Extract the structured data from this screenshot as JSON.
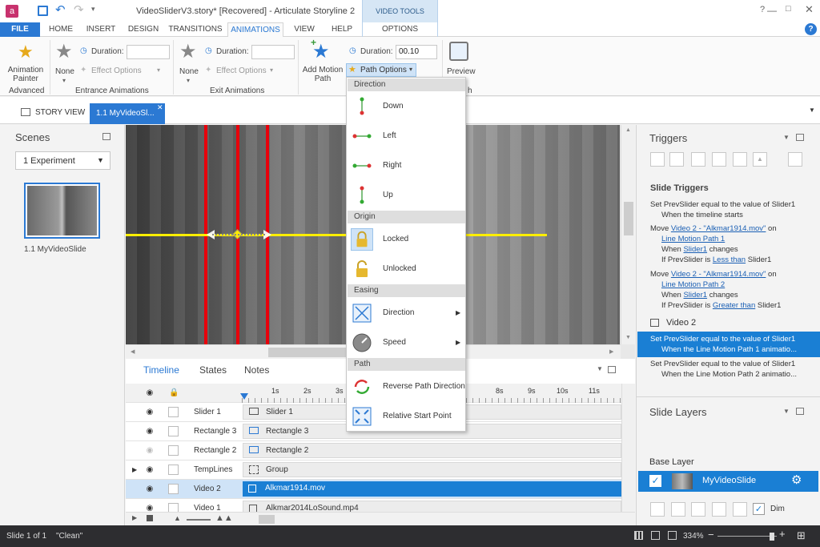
{
  "window": {
    "title": "VideoSliderV3.story* [Recovered] - Articulate Storyline 2",
    "context_group": "VIDEO TOOLS"
  },
  "ribbon": {
    "tabs": [
      "FILE",
      "HOME",
      "INSERT",
      "DESIGN",
      "TRANSITIONS",
      "ANIMATIONS",
      "VIEW",
      "HELP",
      "OPTIONS"
    ],
    "active_tab": "ANIMATIONS",
    "animation_painter": "Animation Painter",
    "advanced_label": "Advanced",
    "entrance": {
      "none_label": "None",
      "duration_label": "Duration:",
      "effect_options": "Effect Options",
      "group_label": "Entrance Animations"
    },
    "exit": {
      "none_label": "None",
      "duration_label": "Duration:",
      "effect_options": "Effect Options",
      "group_label": "Exit Animations"
    },
    "motion": {
      "add_label": "Add Motion Path",
      "path_options": "Path Options",
      "duration_label": "Duration:",
      "duration_value": "00.10"
    },
    "preview_label": "Preview",
    "preview_group_tail": "h"
  },
  "doc_tabs": {
    "story_view": "STORY VIEW",
    "active": "1.1 MyVideoSl..."
  },
  "scenes": {
    "title": "Scenes",
    "dropdown": "1 Experiment",
    "thumb_label": "1.1 MyVideoSlide"
  },
  "path_menu": {
    "sections": [
      {
        "header": "Direction",
        "items": [
          "Down",
          "Left",
          "Right",
          "Up"
        ]
      },
      {
        "header": "Origin",
        "items": [
          "Locked",
          "Unlocked"
        ]
      },
      {
        "header": "Easing",
        "items": [
          "Direction",
          "Speed"
        ]
      },
      {
        "header": "Path",
        "items": [
          "Reverse Path Direction",
          "Relative Start Point"
        ]
      }
    ]
  },
  "timeline": {
    "tabs": [
      "Timeline",
      "States",
      "Notes"
    ],
    "ticks": [
      "1s",
      "2s",
      "3s",
      "8s",
      "9s",
      "10s",
      "11s"
    ],
    "rows": [
      {
        "name": "Slider 1",
        "bar": "Slider 1"
      },
      {
        "name": "Rectangle 3",
        "bar": "Rectangle 3"
      },
      {
        "name": "Rectangle 2",
        "bar": "Rectangle 2"
      },
      {
        "name": "TempLines",
        "bar": "Group"
      },
      {
        "name": "Video 2",
        "bar": "Alkmar1914.mov"
      },
      {
        "name": "Video 1",
        "bar": "Alkmar2014LoSound.mp4"
      }
    ]
  },
  "triggers": {
    "title": "Triggers",
    "slide_triggers": "Slide Triggers",
    "t1": {
      "l1": "Set PrevSlider equal to the value of Slider1",
      "l2": "When the timeline starts"
    },
    "t2": {
      "move": "Move",
      "obj": "Video 2 - \"Alkmar1914.mov\"",
      "on": "on",
      "path": "Line Motion Path 1",
      "when": "When",
      "slider": "Slider1",
      "changes": "changes",
      "if": "If PrevSlider is",
      "cond": "Less than",
      "val": "Slider1"
    },
    "t3": {
      "move": "Move",
      "obj": "Video 2 - \"Alkmar1914.mov\"",
      "on": "on",
      "path": "Line Motion Path 2",
      "when": "When",
      "slider": "Slider1",
      "changes": "changes",
      "if": "If PrevSlider is",
      "cond": "Greater than",
      "val": "Slider1"
    },
    "video2": "Video 2",
    "t4": {
      "l1": "Set PrevSlider equal to the value of Slider1",
      "l2": "When the Line Motion Path 1 animatio..."
    },
    "t5": {
      "l1": "Set PrevSlider equal to the value of Slider1",
      "l2": "When the Line Motion Path 2 animatio..."
    }
  },
  "layers": {
    "title": "Slide Layers",
    "base": "Base Layer",
    "slide": "MyVideoSlide",
    "dim": "Dim"
  },
  "status": {
    "slide": "Slide 1 of 1",
    "state": "\"Clean\"",
    "zoom": "334%"
  },
  "colors": {
    "accent": "#2b79d3",
    "selected": "#1a7fd4",
    "title_icon": "#c8326e",
    "motion_line": "#ffee00",
    "guide_line": "#e8000b"
  }
}
